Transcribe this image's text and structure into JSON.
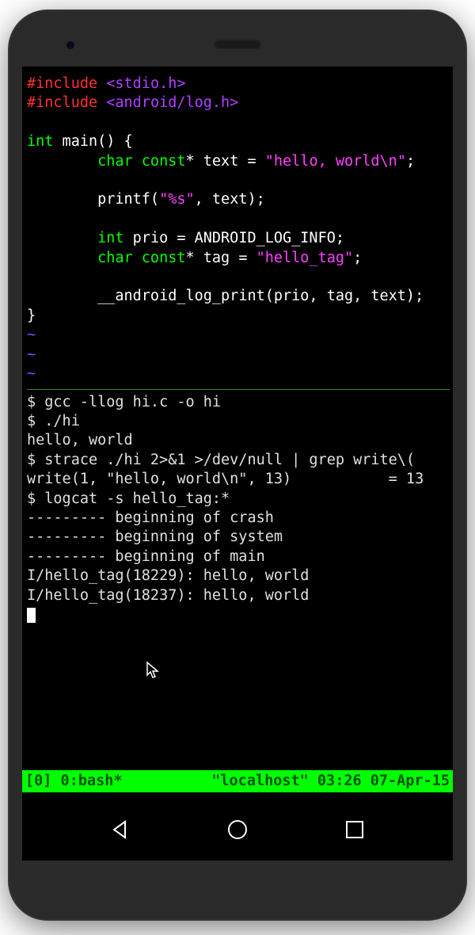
{
  "code": {
    "include1": {
      "directive": "#include",
      "header": "<stdio.h>"
    },
    "include2": {
      "directive": "#include",
      "header": "<android/log.h>"
    },
    "fn_type": "int",
    "fn_sig": " main() {",
    "decl1_kw": "char const",
    "decl1_rest": "* text = ",
    "decl1_str": "\"hello, world\\n\"",
    "printf_call": "printf(",
    "printf_fmt": "\"%s\"",
    "printf_rest": ", text);",
    "decl2_kw": "int",
    "decl2_rest": " prio = ANDROID_LOG_INFO;",
    "decl3_kw": "char const",
    "decl3_rest": "* tag = ",
    "decl3_str": "\"hello_tag\"",
    "log_call": "__android_log_print(prio, tag, text);",
    "close_brace": "}",
    "tilde": "~"
  },
  "terminal": {
    "l1": "$ gcc -llog hi.c -o hi",
    "l2": "$ ./hi",
    "l3": "hello, world",
    "l4": "$ strace ./hi 2>&1 >/dev/null | grep write\\(",
    "l5": "write(1, \"hello, world\\n\", 13)           = 13",
    "l6": "$ logcat -s hello_tag:*",
    "l7": "--------- beginning of crash",
    "l8": "--------- beginning of system",
    "l9": "--------- beginning of main",
    "l10": "I/hello_tag(18229): hello, world",
    "l11": "I/hello_tag(18237): hello, world"
  },
  "tmux": {
    "left": "[0] 0:bash*",
    "right": "\"localhost\" 03:26 07-Apr-15"
  }
}
